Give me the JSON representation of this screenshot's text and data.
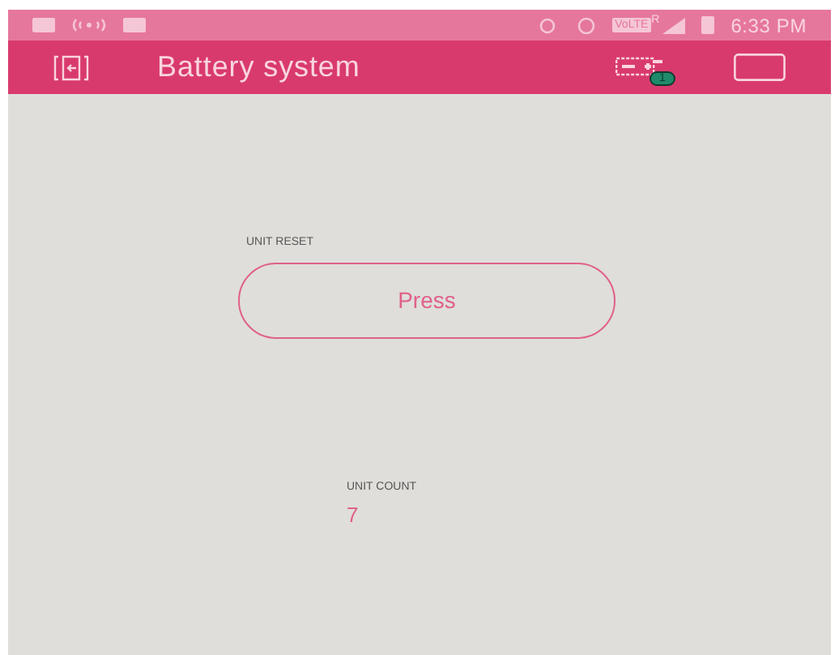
{
  "status_bar": {
    "volte": "VoLTE",
    "roaming": "R",
    "time": "6:33 PM"
  },
  "app_bar": {
    "title": "Battery system",
    "badge": "1"
  },
  "widgets": [
    {
      "kind": "button",
      "label": "UNIT RESET",
      "text": "Press"
    },
    {
      "kind": "value",
      "label": "UNIT COUNT",
      "value": "7"
    }
  ]
}
